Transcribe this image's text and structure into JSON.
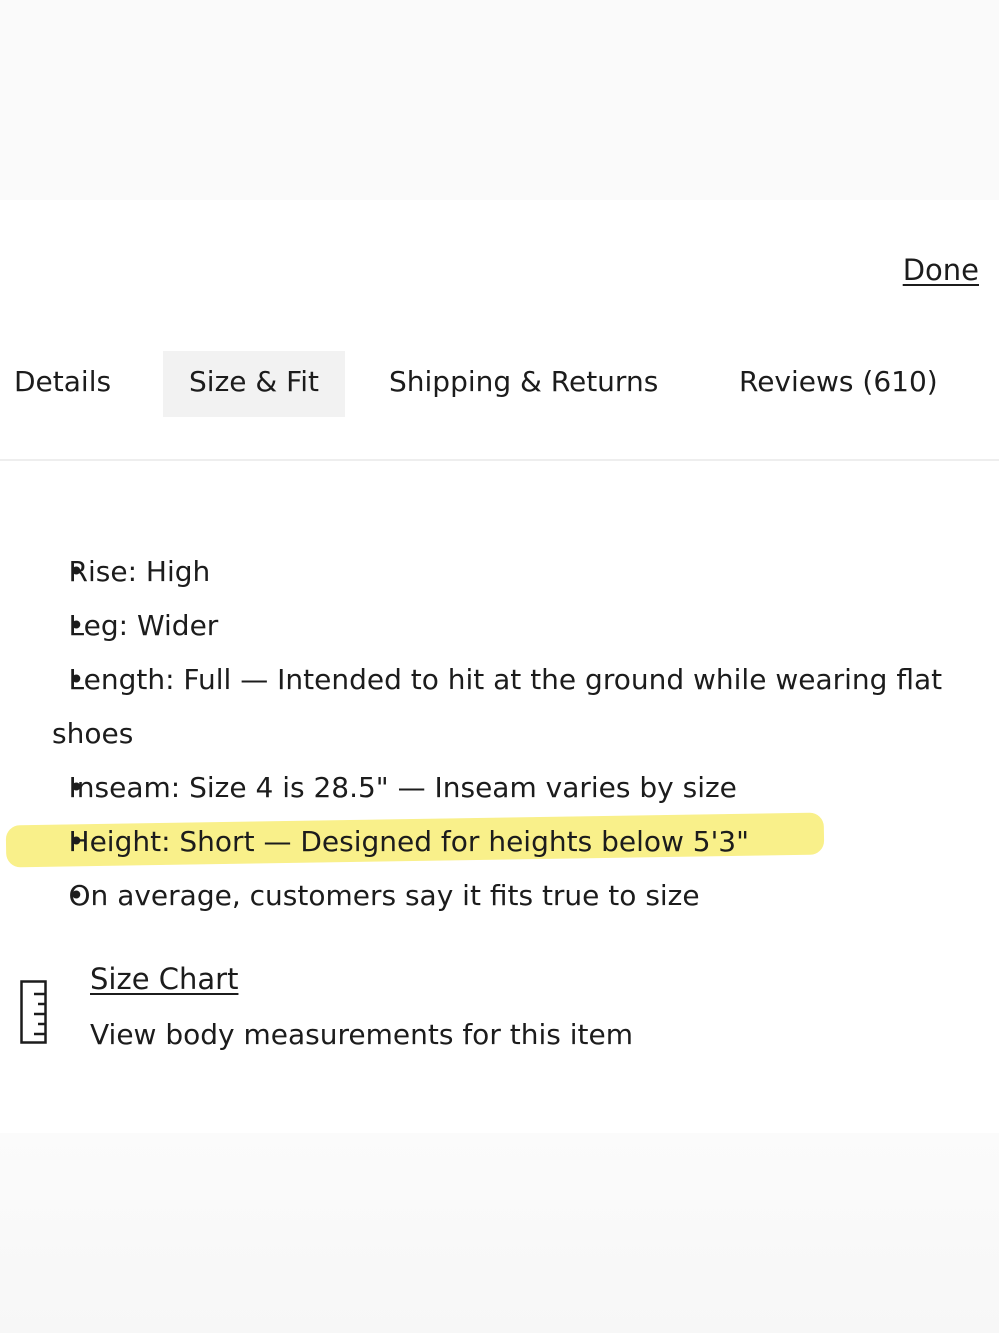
{
  "header": {
    "done_label": "Done"
  },
  "tabs": [
    {
      "label": "Details",
      "active": false
    },
    {
      "label": "Size & Fit",
      "active": true
    },
    {
      "label": "Shipping & Returns",
      "active": false
    },
    {
      "label": "Reviews (610)",
      "active": false
    }
  ],
  "fit_details": [
    {
      "text": "Rise: High",
      "highlighted": false
    },
    {
      "text": "Leg: Wider",
      "highlighted": false
    },
    {
      "text": "Length: Full — Intended to hit at the ground while wearing flat shoes",
      "highlighted": false
    },
    {
      "text": "Inseam: Size 4 is 28.5\" — Inseam varies by size",
      "highlighted": false
    },
    {
      "text": "Height: Short — Designed for heights below 5'3\"",
      "highlighted": true
    },
    {
      "text": "On average, customers say it fits true to size",
      "highlighted": false
    }
  ],
  "size_chart": {
    "icon": "ruler-icon",
    "link_label": "Size Chart",
    "description": "View body measurements for this item"
  },
  "colors": {
    "text": "#1c1c1c",
    "active_tab_bg": "#f2f2f2",
    "highlight": "#f9f08a"
  }
}
